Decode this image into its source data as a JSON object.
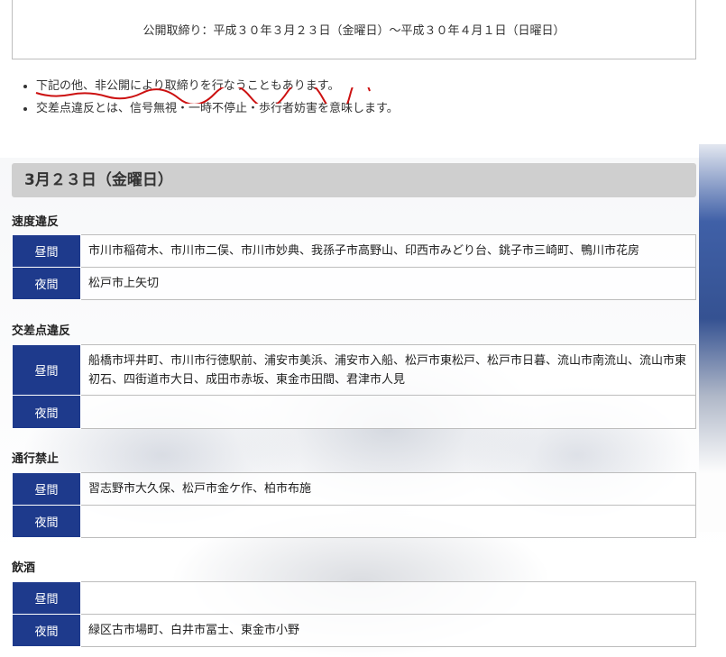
{
  "notice": {
    "period_text": "公開取締り：平成３０年３月２３日（金曜日）〜平成３０年４月１日（日曜日）"
  },
  "notes": [
    "下記の他、非公開により取締りを行なうこともあります。",
    "交差点違反とは、信号無視・一時不停止・歩行者妨害を意味します。"
  ],
  "colors": {
    "period_cell": "#1e3a8c",
    "day_header": "#cfcfcf",
    "underline": "#cc1111"
  },
  "day": {
    "title": "3月２３日（金曜日）",
    "categories": [
      {
        "title": "速度違反",
        "rows": [
          {
            "period": "昼間",
            "places": "市川市稲荷木、市川市二俣、市川市妙典、我孫子市高野山、印西市みどり台、銚子市三崎町、鴨川市花房"
          },
          {
            "period": "夜間",
            "places": "松戸市上矢切"
          }
        ]
      },
      {
        "title": "交差点違反",
        "rows": [
          {
            "period": "昼間",
            "places": "船橋市坪井町、市川市行徳駅前、浦安市美浜、浦安市入船、松戸市東松戸、松戸市日暮、流山市南流山、流山市東初石、四街道市大日、成田市赤坂、東金市田間、君津市人見"
          },
          {
            "period": "夜間",
            "places": ""
          }
        ]
      },
      {
        "title": "通行禁止",
        "rows": [
          {
            "period": "昼間",
            "places": "習志野市大久保、松戸市金ケ作、柏市布施"
          },
          {
            "period": "夜間",
            "places": ""
          }
        ]
      },
      {
        "title": "飲酒",
        "rows": [
          {
            "period": "昼間",
            "places": ""
          },
          {
            "period": "夜間",
            "places": "緑区古市場町、白井市冨士、東金市小野"
          }
        ]
      }
    ]
  }
}
